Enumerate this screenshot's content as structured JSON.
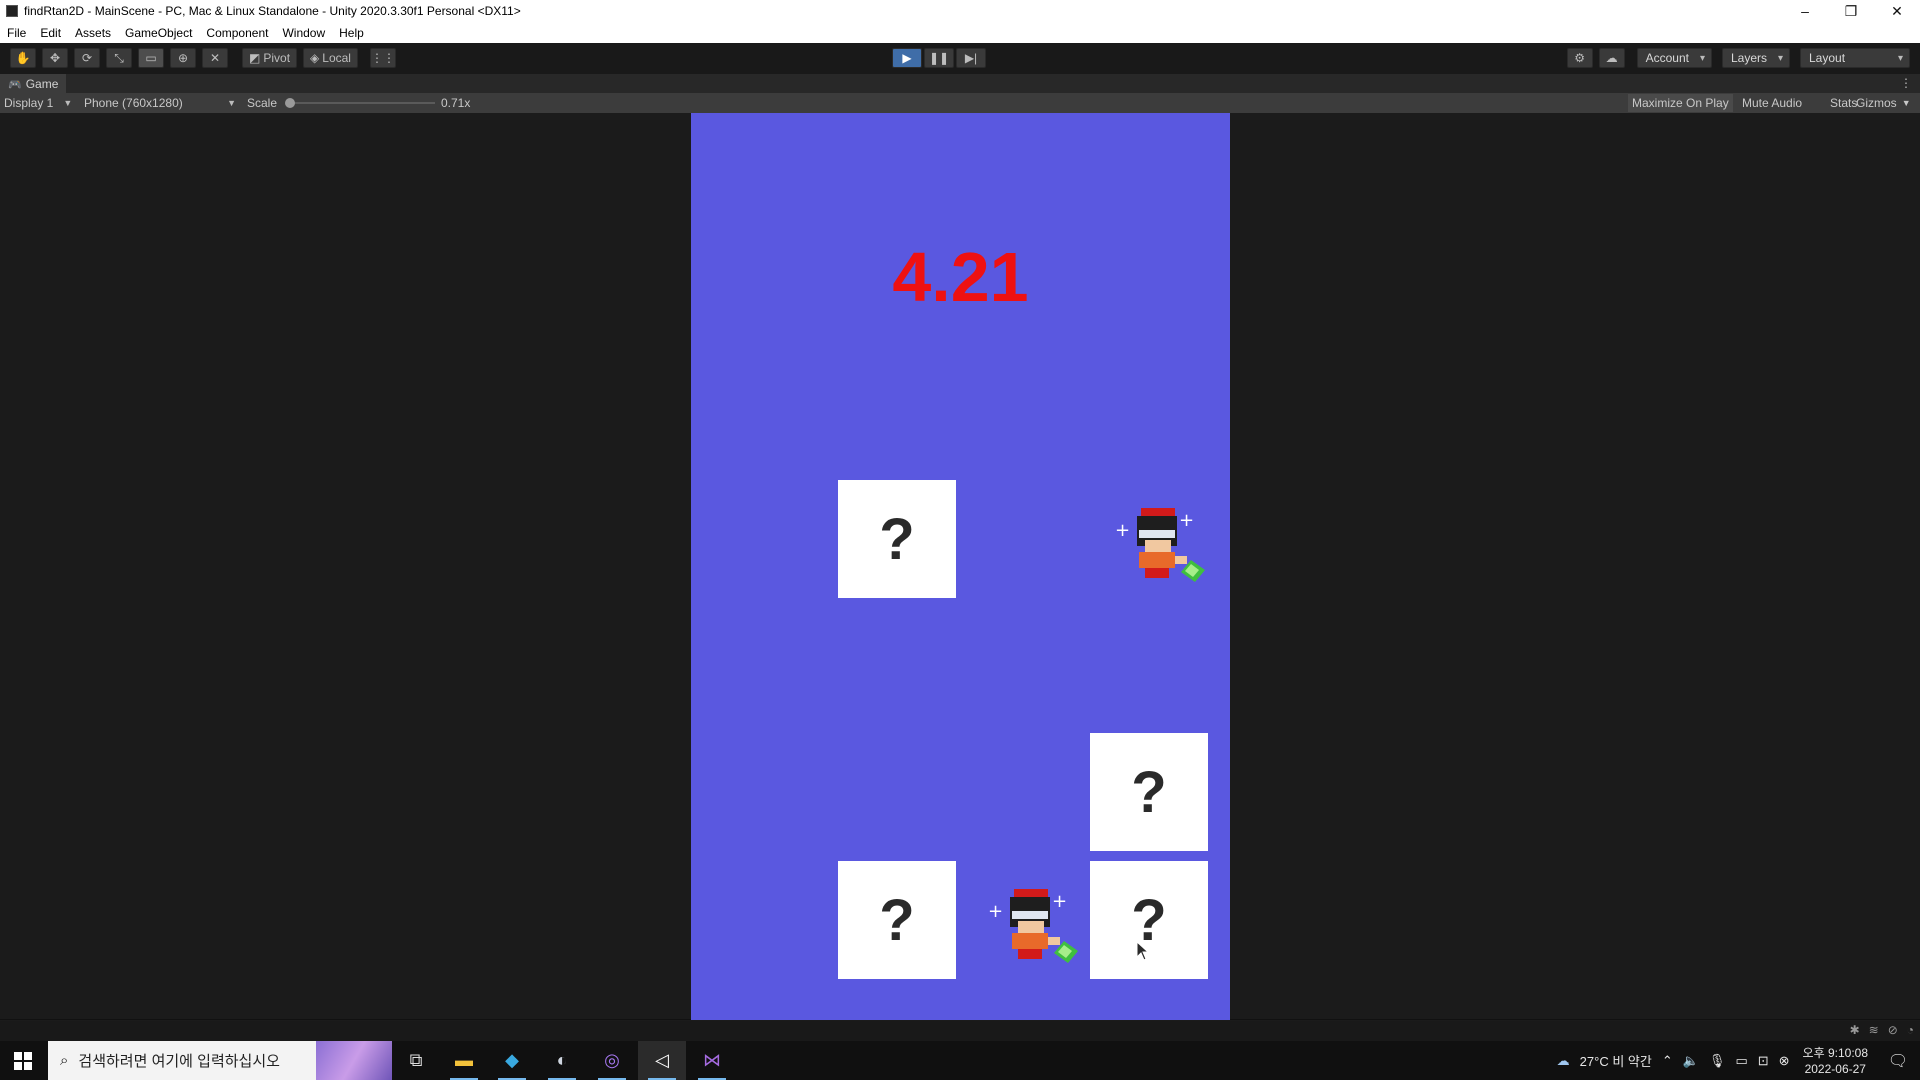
{
  "window": {
    "title": "findRtan2D - MainScene - PC, Mac & Linux Standalone - Unity 2020.3.30f1 Personal <DX11>",
    "controls": [
      "–",
      "❐",
      "✕"
    ]
  },
  "menu": {
    "items": [
      "File",
      "Edit",
      "Assets",
      "GameObject",
      "Component",
      "Window",
      "Help"
    ]
  },
  "toolbar": {
    "pivot_label": "Pivot",
    "local_label": "Local",
    "account_label": "Account",
    "layers_label": "Layers",
    "layout_label": "Layout"
  },
  "game_tab": {
    "label": "Game"
  },
  "game_bar": {
    "display": "Display 1",
    "resolution": "Phone (760x1280)",
    "scale_label": "Scale",
    "scale_value": "0.71x",
    "scale_fraction": 0.0,
    "maximize_on_play": "Maximize On Play",
    "mute_audio": "Mute Audio",
    "stats": "Stats",
    "gizmos": "Gizmos"
  },
  "game": {
    "timer": "4.21",
    "background_color": "#5a58e0",
    "timer_color": "#ee1111",
    "card_glyph": "?"
  },
  "taskbar": {
    "search_placeholder": "검색하려면 여기에 입력하십시오",
    "weather": "27°C 비 약간",
    "time": "오후 9:10:08",
    "date": "2022-06-27"
  }
}
